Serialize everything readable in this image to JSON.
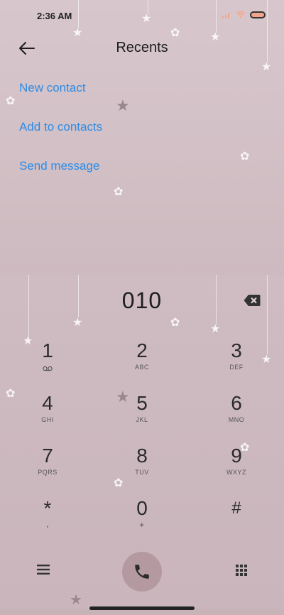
{
  "status_bar": {
    "time": "2:36 AM"
  },
  "header": {
    "title": "Recents",
    "back_icon": "arrow-left-icon"
  },
  "actions": [
    {
      "label": "New contact"
    },
    {
      "label": "Add to contacts"
    },
    {
      "label": "Send message"
    }
  ],
  "dialer": {
    "number": "010",
    "keys": [
      {
        "digit": "1",
        "letters": ""
      },
      {
        "digit": "2",
        "letters": "ABC"
      },
      {
        "digit": "3",
        "letters": "DEF"
      },
      {
        "digit": "4",
        "letters": "GHI"
      },
      {
        "digit": "5",
        "letters": "JKL"
      },
      {
        "digit": "6",
        "letters": "MNO"
      },
      {
        "digit": "7",
        "letters": "PQRS"
      },
      {
        "digit": "8",
        "letters": "TUV"
      },
      {
        "digit": "9",
        "letters": "WXYZ"
      },
      {
        "digit": "*",
        "letters": ","
      },
      {
        "digit": "0",
        "letters": "+"
      },
      {
        "digit": "#",
        "letters": ""
      }
    ]
  },
  "colors": {
    "accent": "#2d8be6",
    "call_button": "#b49aa0"
  }
}
